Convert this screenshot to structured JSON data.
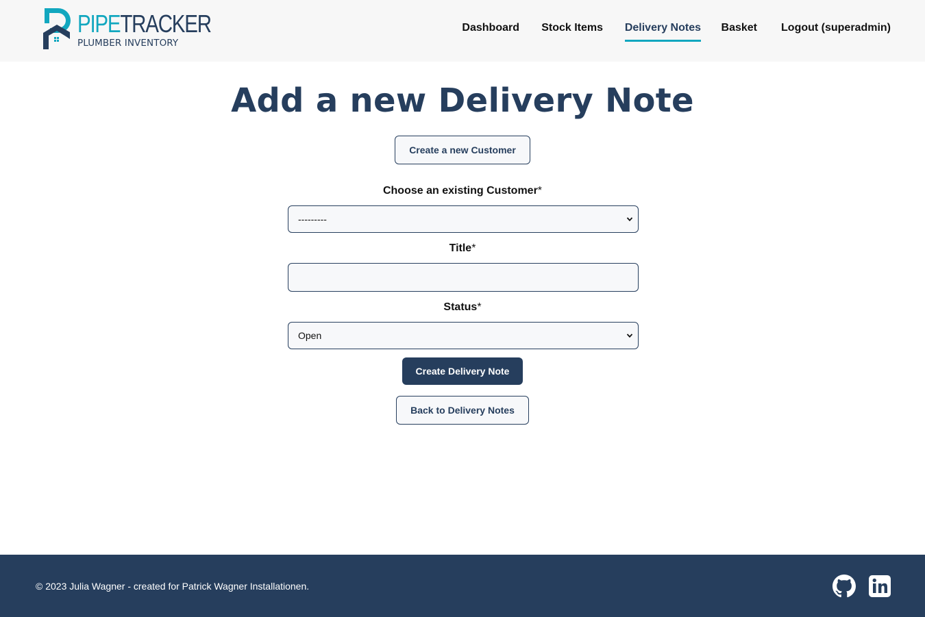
{
  "brand": {
    "word_a": "PIPE",
    "word_b": "TRACKER",
    "subtitle": "PLUMBER INVENTORY",
    "colors": {
      "primary": "#263e5d",
      "accent": "#12a7bf"
    }
  },
  "nav": {
    "items": [
      {
        "label": "Dashboard",
        "active": false
      },
      {
        "label": "Stock Items",
        "active": false
      },
      {
        "label": "Delivery Notes",
        "active": true
      },
      {
        "label": "Basket",
        "active": false
      },
      {
        "label": "Logout (superadmin)",
        "active": false
      }
    ]
  },
  "page": {
    "title": "Add a new Delivery Note",
    "create_customer_button": "Create a new Customer",
    "customer_label": "Choose an existing Customer",
    "customer_selected": "---------",
    "title_label": "Title",
    "title_value": "",
    "status_label": "Status",
    "status_selected": "Open",
    "required_marker": "*",
    "submit_button": "Create Delivery Note",
    "back_button": "Back to Delivery Notes"
  },
  "footer": {
    "copyright": "© 2023 Julia Wagner - created for Patrick Wagner Installationen.",
    "icons": [
      "github-icon",
      "linkedin-icon"
    ]
  }
}
